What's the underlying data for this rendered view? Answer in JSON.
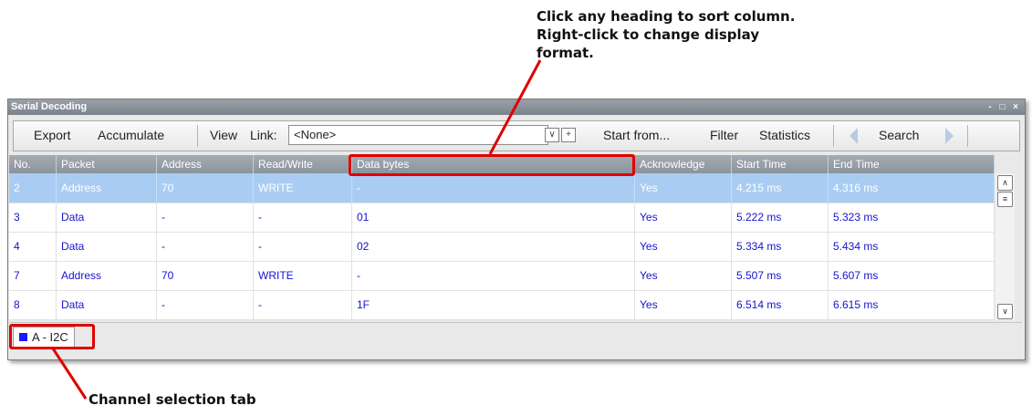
{
  "callouts": {
    "sort_hint": "Click any heading to sort column. Right-click to change display format.",
    "channel_hint": "Channel selection tab"
  },
  "window": {
    "title": "Serial Decoding",
    "controls": "- □ ×"
  },
  "toolbar": {
    "export": "Export",
    "accumulate": "Accumulate",
    "view": "View",
    "link_label": "Link:",
    "link_value": "<None>",
    "dropdown_icon": "chevron-down-icon",
    "add_icon": "plus-icon",
    "start_from": "Start from...",
    "filter": "Filter",
    "statistics": "Statistics",
    "search": "Search"
  },
  "table": {
    "columns": [
      "No.",
      "Packet",
      "Address",
      "Read/Write",
      "Data bytes",
      "Acknowledge",
      "Start Time",
      "End Time"
    ],
    "rows": [
      {
        "no": "2",
        "packet": "Address",
        "address": "70",
        "rw": "WRITE",
        "data": "-",
        "ack": "Yes",
        "start": "4.215 ms",
        "end": "4.316 ms",
        "selected": true
      },
      {
        "no": "3",
        "packet": "Data",
        "address": "-",
        "rw": "-",
        "data": "01",
        "ack": "Yes",
        "start": "5.222 ms",
        "end": "5.323 ms"
      },
      {
        "no": "4",
        "packet": "Data",
        "address": "-",
        "rw": "-",
        "data": "02",
        "ack": "Yes",
        "start": "5.334 ms",
        "end": "5.434 ms"
      },
      {
        "no": "7",
        "packet": "Address",
        "address": "70",
        "rw": "WRITE",
        "data": "-",
        "ack": "Yes",
        "start": "5.507 ms",
        "end": "5.607 ms"
      },
      {
        "no": "8",
        "packet": "Data",
        "address": "-",
        "rw": "-",
        "data": "1F",
        "ack": "Yes",
        "start": "6.514 ms",
        "end": "6.615 ms"
      }
    ]
  },
  "channel_tab": {
    "label": "A - I2C",
    "color": "#1a1aff"
  },
  "colors": {
    "highlight": "#e00000",
    "row_text": "#1414d2",
    "selected_row": "#a9cdf2"
  }
}
